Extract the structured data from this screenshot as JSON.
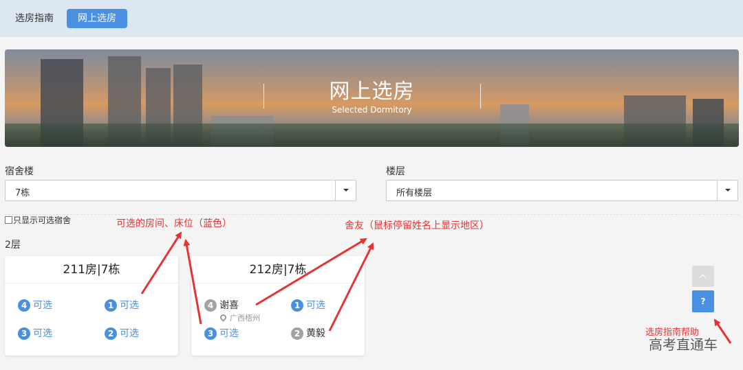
{
  "header": {
    "tabs": [
      {
        "label": "选房指南"
      },
      {
        "label": "网上选房"
      }
    ]
  },
  "banner": {
    "title": "网上选房",
    "subtitle": "Selected Dormitory"
  },
  "filters": {
    "building_label": "宿舍楼",
    "building_value": "7栋",
    "floor_label": "楼层",
    "floor_value": "所有楼层",
    "only_available_label": "只显示可选宿舍"
  },
  "floor_heading": "2层",
  "rooms": [
    {
      "title": "211房|7栋",
      "beds": [
        {
          "number": "4",
          "text": "可选"
        },
        {
          "number": "1",
          "text": "可选"
        },
        {
          "number": "3",
          "text": "可选"
        },
        {
          "number": "2",
          "text": "可选"
        }
      ]
    },
    {
      "title": "212房|7栋",
      "beds": [
        {
          "number": "4",
          "text": "谢喜",
          "region": "广西梧州"
        },
        {
          "number": "1",
          "text": "可选"
        },
        {
          "number": "3",
          "text": "可选"
        },
        {
          "number": "2",
          "text": "黄毅"
        }
      ]
    }
  ],
  "help_button": "?",
  "annotations": {
    "available": "可选的房间、床位（蓝色）",
    "roommate": "舍友（鼠标停留姓名上显示地区）",
    "help": "选房指南帮助"
  },
  "watermark": "高考直通车",
  "colors": {
    "accent": "#4a90e2",
    "occupied": "#a2a2a2",
    "annotation": "#e53333"
  }
}
